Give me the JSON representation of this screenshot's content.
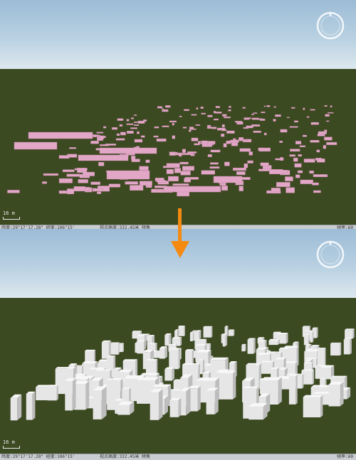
{
  "top_panel": {
    "scale_label": "16 m",
    "status_coords": "纬度:29°17'17.28\" 经度:106°15'",
    "status_extra": "视点高度:332.45米 倾角",
    "status_right": "帧率:60"
  },
  "bottom_panel": {
    "scale_label": "16 m",
    "status_coords": "纬度:29°17'17.28\" 经度:106°15'",
    "status_extra": "视点高度:332.45米 倾角",
    "status_right": "帧率:60"
  },
  "colors": {
    "footprint": "#e2a6c6",
    "building": "#e6e6e6",
    "arrow": "#f58a10",
    "ground": "#3c4a22"
  },
  "icons": [
    "compass-icon",
    "down-arrow-icon"
  ]
}
